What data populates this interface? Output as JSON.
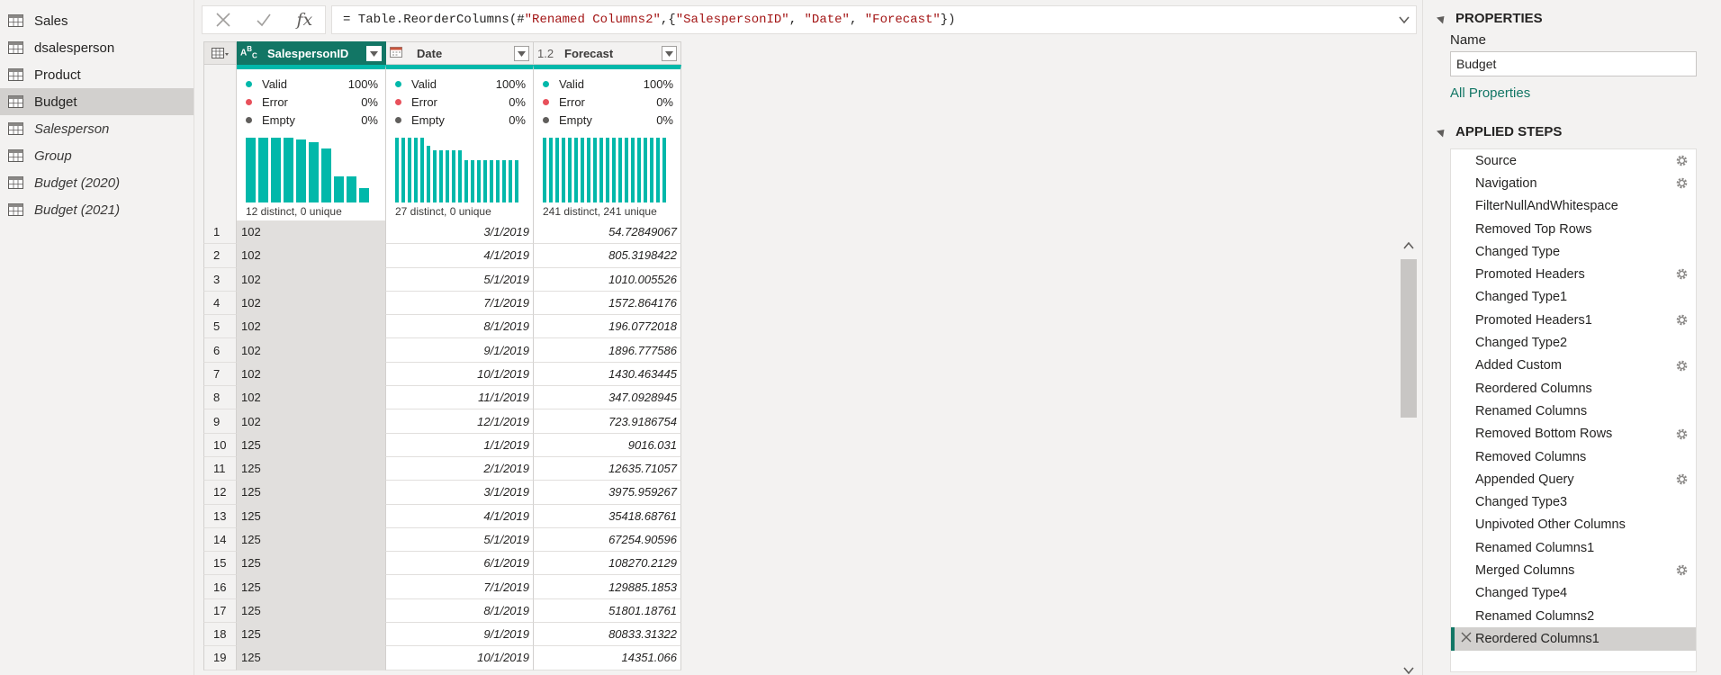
{
  "queries": [
    {
      "label": "Sales",
      "italic": false,
      "selected": false
    },
    {
      "label": "dsalesperson",
      "italic": false,
      "selected": false
    },
    {
      "label": "Product",
      "italic": false,
      "selected": false
    },
    {
      "label": "Budget",
      "italic": false,
      "selected": true
    },
    {
      "label": "Salesperson",
      "italic": true,
      "selected": false
    },
    {
      "label": "Group",
      "italic": true,
      "selected": false
    },
    {
      "label": "Budget (2020)",
      "italic": true,
      "selected": false
    },
    {
      "label": "Budget (2021)",
      "italic": true,
      "selected": false
    }
  ],
  "formula_bar": {
    "cancel_icon": "close-icon",
    "commit_icon": "check-icon",
    "fx": "fx",
    "formula_prefix": "= Table.ReorderColumns(#",
    "formula_s1": "\"Renamed Columns2\"",
    "formula_mid1": ",{",
    "formula_s2": "\"SalespersonID\"",
    "formula_sep1": ", ",
    "formula_s3": "\"Date\"",
    "formula_sep2": ", ",
    "formula_s4": "\"Forecast\"",
    "formula_suffix": "})"
  },
  "columns": [
    {
      "name": "SalespersonID",
      "type_icon": "ABC",
      "active": true,
      "valid_label": "Valid",
      "valid_pct": "100%",
      "error_label": "Error",
      "error_pct": "0%",
      "empty_label": "Empty",
      "empty_pct": "0%",
      "distinct": "12 distinct, 0 unique",
      "histogram": [
        1,
        1,
        1,
        1,
        0.97,
        0.93,
        0.84,
        0.4,
        0.4,
        0.22
      ]
    },
    {
      "name": "Date",
      "type_icon": "calendar-icon",
      "active": false,
      "valid_label": "Valid",
      "valid_pct": "100%",
      "error_label": "Error",
      "error_pct": "0%",
      "empty_label": "Empty",
      "empty_pct": "0%",
      "distinct": "27 distinct, 0 unique",
      "histogram": [
        1,
        1,
        1,
        1,
        1,
        0.87,
        0.8,
        0.8,
        0.8,
        0.8,
        0.8,
        0.65,
        0.65,
        0.65,
        0.65,
        0.65,
        0.65,
        0.65,
        0.65,
        0.65
      ]
    },
    {
      "name": "Forecast",
      "type_icon": "1.2",
      "active": false,
      "valid_label": "Valid",
      "valid_pct": "100%",
      "error_label": "Error",
      "error_pct": "0%",
      "empty_label": "Empty",
      "empty_pct": "0%",
      "distinct": "241 distinct, 241 unique",
      "histogram": [
        1,
        1,
        1,
        1,
        1,
        1,
        1,
        1,
        1,
        1,
        1,
        1,
        1,
        1,
        1,
        1,
        1,
        1,
        1,
        1
      ]
    }
  ],
  "rows": [
    [
      "1",
      "102",
      "3/1/2019",
      "54.72849067"
    ],
    [
      "2",
      "102",
      "4/1/2019",
      "805.3198422"
    ],
    [
      "3",
      "102",
      "5/1/2019",
      "1010.005526"
    ],
    [
      "4",
      "102",
      "7/1/2019",
      "1572.864176"
    ],
    [
      "5",
      "102",
      "8/1/2019",
      "196.0772018"
    ],
    [
      "6",
      "102",
      "9/1/2019",
      "1896.777586"
    ],
    [
      "7",
      "102",
      "10/1/2019",
      "1430.463445"
    ],
    [
      "8",
      "102",
      "11/1/2019",
      "347.0928945"
    ],
    [
      "9",
      "102",
      "12/1/2019",
      "723.9186754"
    ],
    [
      "10",
      "125",
      "1/1/2019",
      "9016.031"
    ],
    [
      "11",
      "125",
      "2/1/2019",
      "12635.71057"
    ],
    [
      "12",
      "125",
      "3/1/2019",
      "3975.959267"
    ],
    [
      "13",
      "125",
      "4/1/2019",
      "35418.68761"
    ],
    [
      "14",
      "125",
      "5/1/2019",
      "67254.90596"
    ],
    [
      "15",
      "125",
      "6/1/2019",
      "108270.2129"
    ],
    [
      "16",
      "125",
      "7/1/2019",
      "129885.1853"
    ],
    [
      "17",
      "125",
      "8/1/2019",
      "51801.18761"
    ],
    [
      "18",
      "125",
      "9/1/2019",
      "80833.31322"
    ],
    [
      "19",
      "125",
      "10/1/2019",
      "14351.066"
    ]
  ],
  "properties": {
    "title": "PROPERTIES",
    "name_label": "Name",
    "name_value": "Budget",
    "all_properties": "All Properties"
  },
  "applied_steps": {
    "title": "APPLIED STEPS",
    "steps": [
      {
        "label": "Source",
        "gear": true,
        "current": false
      },
      {
        "label": "Navigation",
        "gear": true,
        "current": false
      },
      {
        "label": "FilterNullAndWhitespace",
        "gear": false,
        "current": false
      },
      {
        "label": "Removed Top Rows",
        "gear": false,
        "current": false
      },
      {
        "label": "Changed Type",
        "gear": false,
        "current": false
      },
      {
        "label": "Promoted Headers",
        "gear": true,
        "current": false
      },
      {
        "label": "Changed Type1",
        "gear": false,
        "current": false
      },
      {
        "label": "Promoted Headers1",
        "gear": true,
        "current": false
      },
      {
        "label": "Changed Type2",
        "gear": false,
        "current": false
      },
      {
        "label": "Added Custom",
        "gear": true,
        "current": false
      },
      {
        "label": "Reordered Columns",
        "gear": false,
        "current": false
      },
      {
        "label": "Renamed Columns",
        "gear": false,
        "current": false
      },
      {
        "label": "Removed Bottom Rows",
        "gear": true,
        "current": false
      },
      {
        "label": "Removed Columns",
        "gear": false,
        "current": false
      },
      {
        "label": "Appended Query",
        "gear": true,
        "current": false
      },
      {
        "label": "Changed Type3",
        "gear": false,
        "current": false
      },
      {
        "label": "Unpivoted Other Columns",
        "gear": false,
        "current": false
      },
      {
        "label": "Renamed Columns1",
        "gear": false,
        "current": false
      },
      {
        "label": "Merged Columns",
        "gear": true,
        "current": false
      },
      {
        "label": "Changed Type4",
        "gear": false,
        "current": false
      },
      {
        "label": "Renamed Columns2",
        "gear": false,
        "current": false
      },
      {
        "label": "Reordered Columns1",
        "gear": false,
        "current": true
      }
    ]
  },
  "colors": {
    "accent": "#127665",
    "profile_bar": "#01b8aa",
    "valid_dot": "#01b8aa",
    "error_dot": "#e8505b",
    "empty_dot": "#605e5c",
    "formula_string": "#a31515"
  }
}
